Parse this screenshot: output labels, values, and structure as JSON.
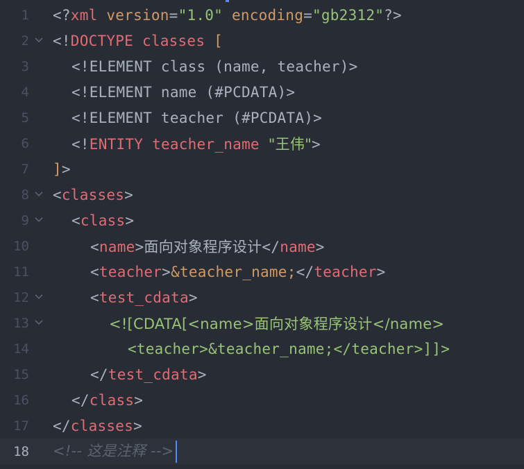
{
  "colors": {
    "background": "#282c34",
    "active_line": "#2c313a",
    "gutter": "#495162",
    "text": "#abb2bf",
    "tag": "#e06c75",
    "attr": "#d19a66",
    "string": "#98c379",
    "comment": "#5c6370",
    "cursor": "#528bff"
  },
  "fold_icon": "chevron-down-icon",
  "active_line": 18,
  "lines": [
    {
      "num": "1",
      "fold": false,
      "indent": 0,
      "tokens": [
        {
          "t": "<?",
          "c": "text"
        },
        {
          "t": "xml",
          "c": "tag"
        },
        {
          "t": " ",
          "c": "text"
        },
        {
          "t": "version",
          "c": "attr"
        },
        {
          "t": "=",
          "c": "text"
        },
        {
          "t": "\"1.0\"",
          "c": "string"
        },
        {
          "t": " ",
          "c": "text"
        },
        {
          "t": "encoding",
          "c": "attr"
        },
        {
          "t": "=",
          "c": "text"
        },
        {
          "t": "\"gb2312\"",
          "c": "string"
        },
        {
          "t": "?>",
          "c": "text"
        }
      ]
    },
    {
      "num": "2",
      "fold": true,
      "indent": 0,
      "tokens": [
        {
          "t": "<!",
          "c": "text"
        },
        {
          "t": "DOCTYPE",
          "c": "tag"
        },
        {
          "t": " ",
          "c": "text"
        },
        {
          "t": "classes",
          "c": "tag"
        },
        {
          "t": " [",
          "c": "attr"
        }
      ]
    },
    {
      "num": "3",
      "fold": false,
      "indent": 2,
      "tokens": [
        {
          "t": "<!ELEMENT class (name, teacher)>",
          "c": "text"
        }
      ]
    },
    {
      "num": "4",
      "fold": false,
      "indent": 2,
      "tokens": [
        {
          "t": "<!ELEMENT name (#PCDATA)>",
          "c": "text"
        }
      ]
    },
    {
      "num": "5",
      "fold": false,
      "indent": 2,
      "tokens": [
        {
          "t": "<!ELEMENT teacher (#PCDATA)>",
          "c": "text"
        }
      ]
    },
    {
      "num": "6",
      "fold": false,
      "indent": 2,
      "tokens": [
        {
          "t": "<!",
          "c": "text"
        },
        {
          "t": "ENTITY",
          "c": "tag"
        },
        {
          "t": " ",
          "c": "text"
        },
        {
          "t": "teacher_name",
          "c": "tag"
        },
        {
          "t": " ",
          "c": "text"
        },
        {
          "t": "\"王伟\"",
          "c": "string"
        },
        {
          "t": ">",
          "c": "text"
        }
      ]
    },
    {
      "num": "7",
      "fold": false,
      "indent": 0,
      "tokens": [
        {
          "t": "]",
          "c": "attr"
        },
        {
          "t": ">",
          "c": "text"
        }
      ]
    },
    {
      "num": "8",
      "fold": true,
      "indent": 0,
      "tokens": [
        {
          "t": "<",
          "c": "text"
        },
        {
          "t": "classes",
          "c": "tag"
        },
        {
          "t": ">",
          "c": "text"
        }
      ]
    },
    {
      "num": "9",
      "fold": true,
      "indent": 2,
      "tokens": [
        {
          "t": "<",
          "c": "text"
        },
        {
          "t": "class",
          "c": "tag"
        },
        {
          "t": ">",
          "c": "text"
        }
      ]
    },
    {
      "num": "10",
      "fold": false,
      "indent": 4,
      "tokens": [
        {
          "t": "<",
          "c": "text"
        },
        {
          "t": "name",
          "c": "tag"
        },
        {
          "t": ">",
          "c": "text"
        },
        {
          "t": "面向对象程序设计",
          "c": "text"
        },
        {
          "t": "</",
          "c": "text"
        },
        {
          "t": "name",
          "c": "tag"
        },
        {
          "t": ">",
          "c": "text"
        }
      ]
    },
    {
      "num": "11",
      "fold": false,
      "indent": 4,
      "tokens": [
        {
          "t": "<",
          "c": "text"
        },
        {
          "t": "teacher",
          "c": "tag"
        },
        {
          "t": ">",
          "c": "text"
        },
        {
          "t": "&teacher_name;",
          "c": "attr"
        },
        {
          "t": "</",
          "c": "text"
        },
        {
          "t": "teacher",
          "c": "tag"
        },
        {
          "t": ">",
          "c": "text"
        }
      ]
    },
    {
      "num": "12",
      "fold": true,
      "indent": 4,
      "tokens": [
        {
          "t": "<",
          "c": "text"
        },
        {
          "t": "test_cdata",
          "c": "tag"
        },
        {
          "t": ">",
          "c": "text"
        }
      ]
    },
    {
      "num": "13",
      "fold": true,
      "indent": 6,
      "tokens": [
        {
          "t": "<![CDATA[<name>面向对象程序设计</name>",
          "c": "string"
        }
      ]
    },
    {
      "num": "14",
      "fold": false,
      "indent": 8,
      "tokens": [
        {
          "t": "<teacher>&teacher_name;</teacher>]]>",
          "c": "string"
        }
      ]
    },
    {
      "num": "15",
      "fold": false,
      "indent": 4,
      "tokens": [
        {
          "t": "</",
          "c": "text"
        },
        {
          "t": "test_cdata",
          "c": "tag"
        },
        {
          "t": ">",
          "c": "text"
        }
      ]
    },
    {
      "num": "16",
      "fold": false,
      "indent": 2,
      "tokens": [
        {
          "t": "</",
          "c": "text"
        },
        {
          "t": "class",
          "c": "tag"
        },
        {
          "t": ">",
          "c": "text"
        }
      ]
    },
    {
      "num": "17",
      "fold": false,
      "indent": 0,
      "tokens": [
        {
          "t": "</",
          "c": "text"
        },
        {
          "t": "classes",
          "c": "tag"
        },
        {
          "t": ">",
          "c": "text"
        }
      ]
    },
    {
      "num": "18",
      "fold": false,
      "indent": 0,
      "tokens": [
        {
          "t": "<!-- 这是注释 -->",
          "c": "comment"
        }
      ]
    }
  ]
}
